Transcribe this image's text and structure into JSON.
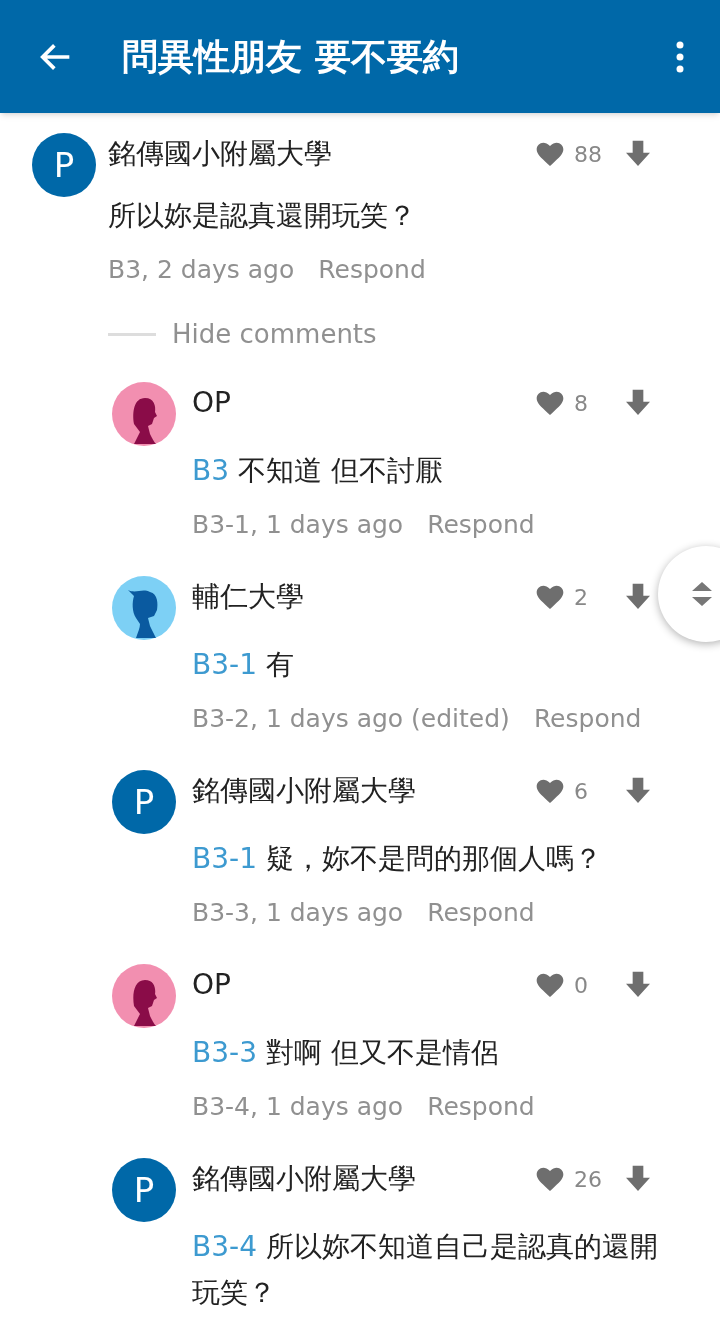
{
  "header": {
    "title": "問異性朋友 要不要約"
  },
  "comment": {
    "avatar": {
      "kind": "letter",
      "letter": "P"
    },
    "author": "銘傳國小附屬大學",
    "likes": "88",
    "text": "所以妳是認真還開玩笑？",
    "meta": "B3, 2 days ago",
    "respond": "Respond"
  },
  "toggle": "Hide comments",
  "replies": [
    {
      "avatar": {
        "kind": "female"
      },
      "author": "OP",
      "likes": "8",
      "ref": "B3",
      "text": "不知道 但不討厭",
      "meta": "B3-1, 1 days ago",
      "respond": "Respond"
    },
    {
      "avatar": {
        "kind": "male"
      },
      "author": "輔仁大學",
      "likes": "2",
      "ref": "B3-1",
      "text": "有",
      "meta": "B3-2, 1 days ago (edited)",
      "respond": "Respond"
    },
    {
      "avatar": {
        "kind": "letter",
        "letter": "P"
      },
      "author": "銘傳國小附屬大學",
      "likes": "6",
      "ref": "B3-1",
      "text": "疑，妳不是問的那個人嗎？",
      "meta": "B3-3, 1 days ago",
      "respond": "Respond"
    },
    {
      "avatar": {
        "kind": "female"
      },
      "author": "OP",
      "likes": "0",
      "ref": "B3-3",
      "text": "對啊 但又不是情侶",
      "meta": "B3-4, 1 days ago",
      "respond": "Respond"
    },
    {
      "avatar": {
        "kind": "letter",
        "letter": "P"
      },
      "author": "銘傳國小附屬大學",
      "likes": "26",
      "ref": "B3-4",
      "text": "所以妳不知道自己是認真的還開玩笑？"
    }
  ]
}
